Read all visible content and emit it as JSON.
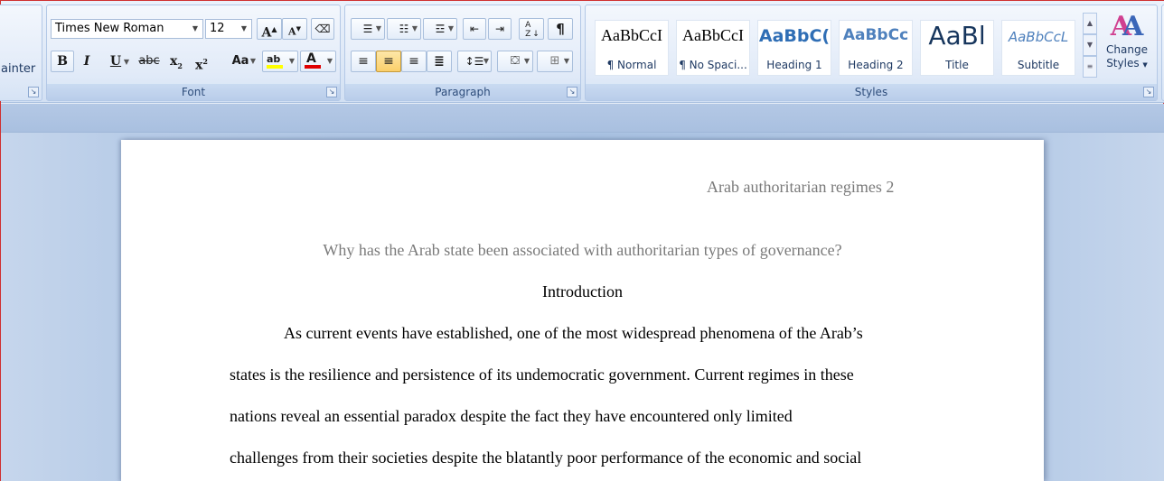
{
  "clipboard": {
    "format_painter_label": "ainter"
  },
  "font_group": {
    "label": "Font",
    "font_name": "Times New Roman",
    "font_size": "12",
    "grow_label": "A",
    "shrink_label": "A",
    "bold": "B",
    "italic": "I",
    "underline": "U",
    "strikethrough": "abc",
    "subscript": "x",
    "superscript": "x",
    "change_case": "Aa",
    "highlight": "ab",
    "font_color": "A"
  },
  "paragraph_group": {
    "label": "Paragraph",
    "pilcrow": "¶",
    "sort": "AZ"
  },
  "styles_group": {
    "label": "Styles",
    "styles": [
      {
        "sample": "AaBbCcI",
        "name": "¶ Normal"
      },
      {
        "sample": "AaBbCcI",
        "name": "¶ No Spaci..."
      },
      {
        "sample": "AaBbC(",
        "name": "Heading 1"
      },
      {
        "sample": "AaBbCc",
        "name": "Heading 2"
      },
      {
        "sample": "AaBl",
        "name": "Title"
      },
      {
        "sample": "AaBbCcL",
        "name": "Subtitle"
      }
    ],
    "change_styles": [
      "Change",
      "Styles"
    ]
  },
  "colors": {
    "highlight": "#ffff00",
    "font_color": "#e00000",
    "accent": "#2e4d7b"
  },
  "document": {
    "header": "Arab authoritarian regimes 2",
    "title": "Why has the Arab state been associated with authoritarian types of governance?",
    "heading": "Introduction",
    "lines": [
      "As current events have established, one of the most widespread phenomena of the Arab’s",
      "states is the resilience and persistence of its undemocratic government. Current regimes in these",
      "nations reveal an essential paradox despite the fact they have encountered only limited",
      "challenges from their societies despite the blatantly poor performance of the economic and social"
    ]
  }
}
